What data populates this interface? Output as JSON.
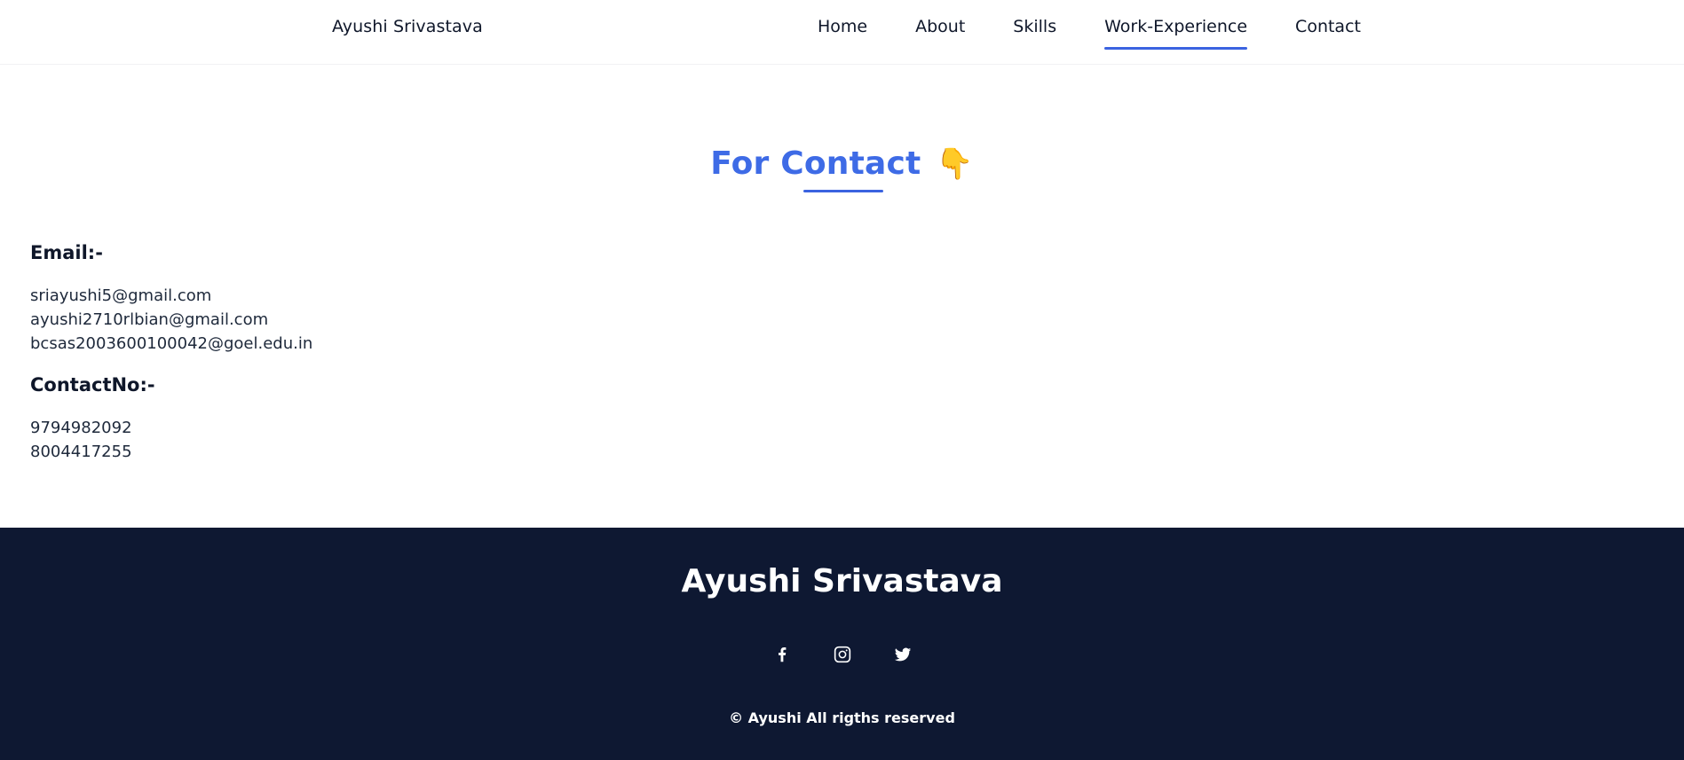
{
  "header": {
    "brand": "Ayushi Srivastava",
    "nav": [
      {
        "label": "Home"
      },
      {
        "label": "About"
      },
      {
        "label": "Skills"
      },
      {
        "label": "Work-Experience",
        "active": true
      },
      {
        "label": "Contact"
      }
    ]
  },
  "contact": {
    "title": "For Contact",
    "title_emoji": "👇",
    "title_emoji_icon": "pointing-down-hand-icon",
    "email_heading": "Email:-",
    "emails": [
      "sriayushi5@gmail.com",
      "ayushi2710rlbian@gmail.com",
      "bcsas2003600100042@goel.edu.in"
    ],
    "phone_heading": "ContactNo:-",
    "phones": [
      "9794982092",
      "8004417255"
    ]
  },
  "footer": {
    "name": "Ayushi Srivastava",
    "socials": [
      {
        "icon": "facebook-icon"
      },
      {
        "icon": "instagram-icon"
      },
      {
        "icon": "twitter-icon"
      }
    ],
    "copyright": "© Ayushi All rigths reserved"
  },
  "colors": {
    "accent": "#3e6be6",
    "footer_bg": "#0e1832",
    "text_dark": "#0f172a"
  }
}
